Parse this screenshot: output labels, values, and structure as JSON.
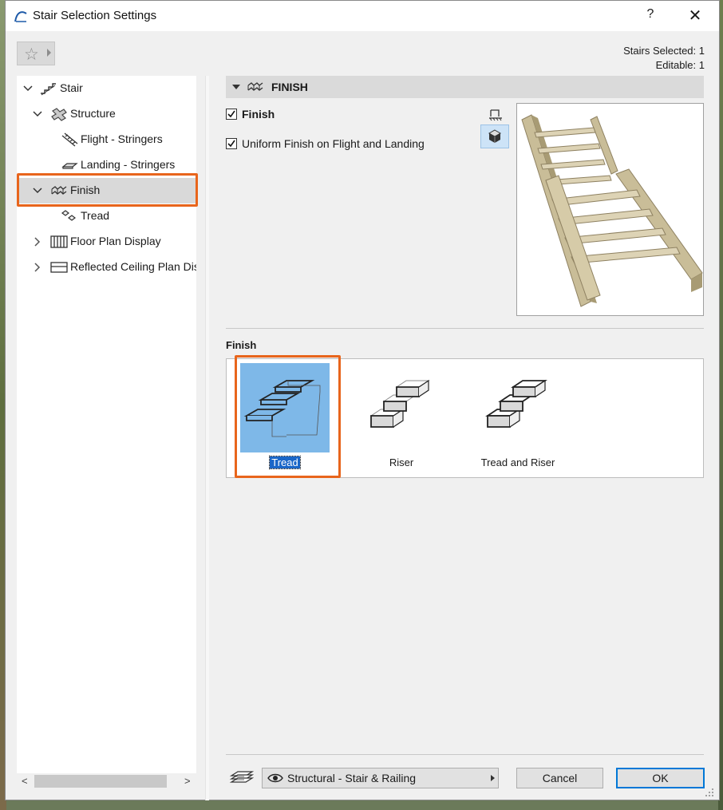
{
  "window": {
    "title": "Stair Selection Settings",
    "help_label": "?",
    "close_label": "✕"
  },
  "selection_info": {
    "selected": "Stairs Selected: 1",
    "editable": "Editable: 1"
  },
  "favorites": {
    "icon": "star-icon"
  },
  "tree": {
    "items": [
      {
        "label": "Stair",
        "icon": "stair-icon",
        "expanded": true,
        "level": 0
      },
      {
        "label": "Structure",
        "icon": "structure-icon",
        "expanded": true,
        "level": 1
      },
      {
        "label": "Flight - Stringers",
        "icon": "flight-stringers-icon",
        "level": 2
      },
      {
        "label": "Landing - Stringers",
        "icon": "landing-stringers-icon",
        "level": 2
      },
      {
        "label": "Finish",
        "icon": "finish-icon",
        "expanded": true,
        "level": 1,
        "selected": true
      },
      {
        "label": "Tread",
        "icon": "tread-icon",
        "level": 2
      },
      {
        "label": "Floor Plan Display",
        "icon": "floor-plan-icon",
        "expanded": false,
        "level": 1
      },
      {
        "label": "Reflected Ceiling Plan Display",
        "icon": "ceiling-plan-icon",
        "expanded": false,
        "level": 1
      }
    ]
  },
  "section": {
    "title": "FINISH"
  },
  "checkboxes": {
    "finish": {
      "label": "Finish",
      "checked": true
    },
    "uniform": {
      "label": "Uniform Finish on Flight and Landing",
      "checked": true
    }
  },
  "finish_group": {
    "label": "Finish",
    "options": [
      {
        "label": "Tread",
        "selected": true
      },
      {
        "label": "Riser",
        "selected": false
      },
      {
        "label": "Tread and Riser",
        "selected": false
      }
    ]
  },
  "footer": {
    "layer": "Structural - Stair & Railing",
    "cancel_label": "Cancel",
    "ok_label": "OK"
  },
  "colors": {
    "highlight": "#e8651c",
    "selection_blue": "#7eb8e8",
    "ok_border": "#0078d7"
  }
}
